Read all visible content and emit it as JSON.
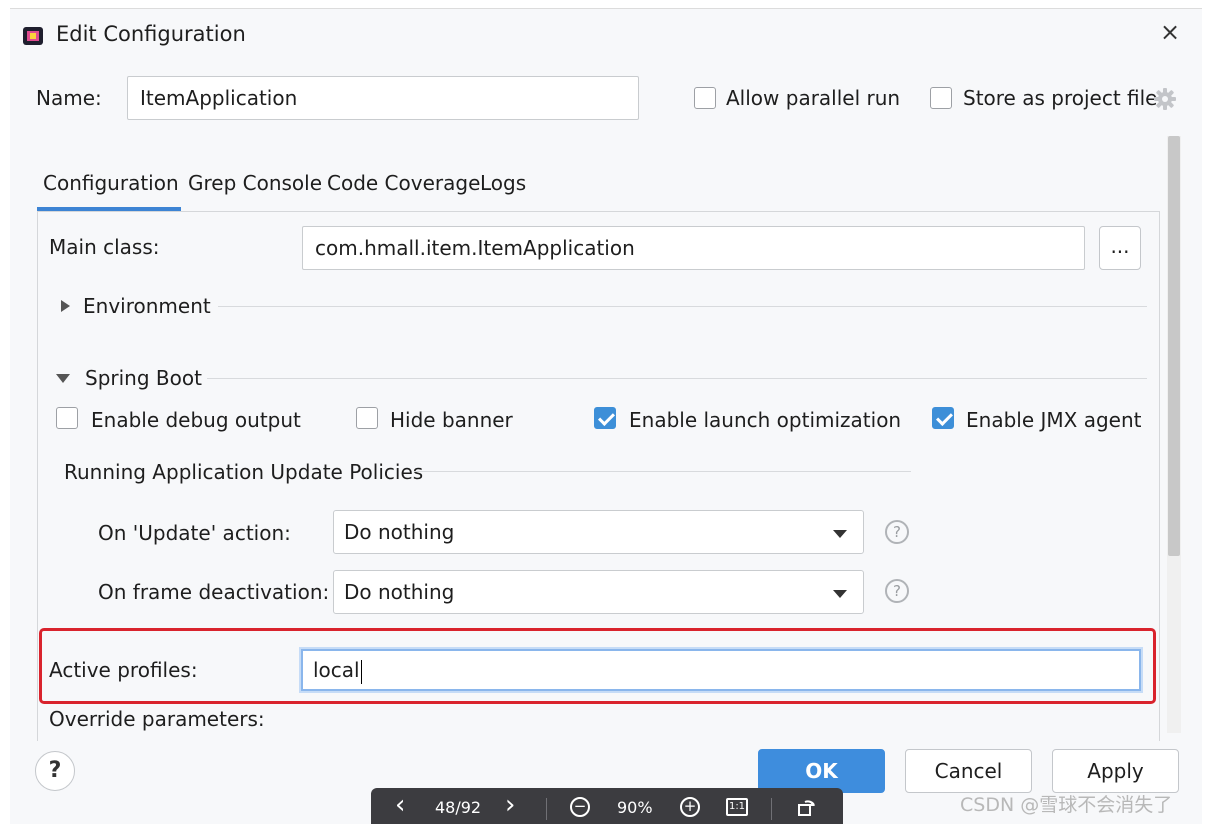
{
  "window": {
    "title": "Edit Configuration",
    "close_label": "×"
  },
  "name_row": {
    "label": "Name:",
    "value": "ItemApplication",
    "allow_parallel_label": "Allow parallel run",
    "allow_parallel_checked": false,
    "store_project_label": "Store as project file",
    "store_project_checked": false
  },
  "tabs": [
    {
      "label": "Configuration",
      "active": true
    },
    {
      "label": "Grep Console",
      "active": false
    },
    {
      "label": "Code Coverage",
      "active": false
    },
    {
      "label": "Logs",
      "active": false
    }
  ],
  "main_class": {
    "label": "Main class:",
    "value": "com.hmall.item.ItemApplication",
    "browse_label": "..."
  },
  "environment": {
    "label": "Environment",
    "expanded": false
  },
  "spring_boot": {
    "label": "Spring Boot",
    "expanded": true,
    "options": [
      {
        "label": "Enable debug output",
        "checked": false
      },
      {
        "label": "Hide banner",
        "checked": false
      },
      {
        "label": "Enable launch optimization",
        "checked": true
      },
      {
        "label": "Enable JMX agent",
        "checked": true
      }
    ],
    "policies_label": "Running Application Update Policies",
    "update_action": {
      "label": "On 'Update' action:",
      "value": "Do nothing"
    },
    "frame_deactivation": {
      "label": "On frame deactivation:",
      "value": "Do nothing"
    },
    "help_glyph": "?"
  },
  "active_profiles": {
    "label": "Active profiles:",
    "value": "local",
    "highlight_color": "#d9232d"
  },
  "override_parameters": {
    "label": "Override parameters:"
  },
  "footer": {
    "help_label": "?",
    "ok_label": "OK",
    "cancel_label": "Cancel",
    "apply_label": "Apply"
  },
  "viewer_toolbar": {
    "prev_glyph": "‹",
    "page": "48/92",
    "next_glyph": "›",
    "zoom_out_glyph": "−",
    "zoom": "90%",
    "zoom_in_glyph": "+",
    "actual_size_glyph": "1:1",
    "rotate_icon": "rotate-icon"
  },
  "watermark": "CSDN @雪球不会消失了",
  "colors": {
    "accent": "#3e8ddd",
    "highlight": "#d9232d",
    "background": "#f7f8fa"
  }
}
